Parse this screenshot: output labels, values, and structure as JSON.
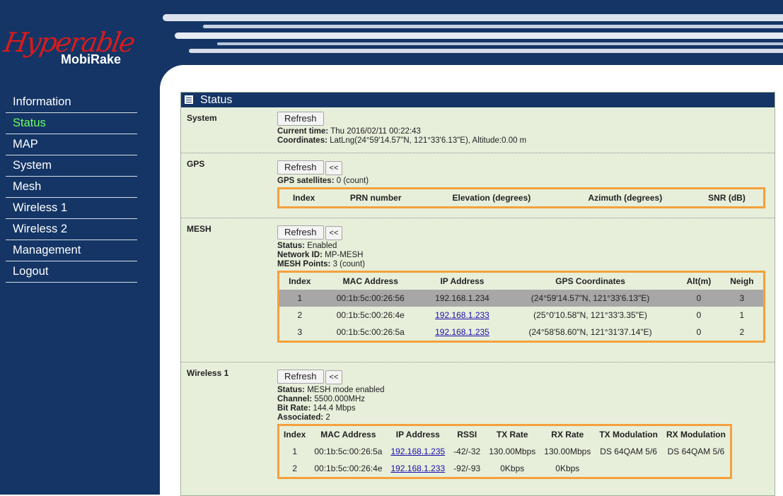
{
  "app": {
    "logo_text": "Hyperable",
    "logo_subtitle": "MobiRake"
  },
  "sidebar": {
    "items": [
      {
        "label": "Information"
      },
      {
        "label": "Status"
      },
      {
        "label": "MAP"
      },
      {
        "label": "System"
      },
      {
        "label": "Mesh"
      },
      {
        "label": "Wireless 1"
      },
      {
        "label": "Wireless 2"
      },
      {
        "label": "Management"
      },
      {
        "label": "Logout"
      }
    ],
    "active": "Status"
  },
  "status": {
    "title": "Status",
    "system": {
      "title": "System",
      "refresh": "Refresh",
      "current_time_label": "Current time:",
      "current_time": "Thu 2016/02/11 00:22:43",
      "coordinates_label": "Coordinates:",
      "coordinates": "LatLng(24°59'14.57\"N, 121°33'6.13\"E), Altitude:0.00 m"
    },
    "gps": {
      "title": "GPS",
      "refresh": "Refresh",
      "back": "<<",
      "satellites_label": "GPS satellites:",
      "satellites": "0 (count)",
      "headers": [
        "Index",
        "PRN number",
        "Elevation (degrees)",
        "Azimuth (degrees)",
        "SNR (dB)"
      ]
    },
    "mesh": {
      "title": "MESH",
      "refresh": "Refresh",
      "back": "<<",
      "status_label": "Status:",
      "status": "Enabled",
      "network_id_label": "Network ID:",
      "network_id": "MP-MESH",
      "points_label": "MESH Points:",
      "points": "3 (count)",
      "headers": [
        "Index",
        "MAC Address",
        "IP Address",
        "GPS Coordinates",
        "Alt(m)",
        "Neigh"
      ],
      "rows": [
        [
          "1",
          "00:1b:5c:00:26:56",
          "192.168.1.234",
          "(24°59'14.57\"N, 121°33'6.13\"E)",
          "0",
          "3"
        ],
        [
          "2",
          "00:1b:5c:00:26:4e",
          "192.168.1.233",
          "(25°0'10.58\"N, 121°33'3.35\"E)",
          "0",
          "1"
        ],
        [
          "3",
          "00:1b:5c:00:26:5a",
          "192.168.1.235",
          "(24°58'58.60\"N, 121°31'37.14\"E)",
          "0",
          "2"
        ]
      ]
    },
    "wireless1": {
      "title": "Wireless 1",
      "refresh": "Refresh",
      "back": "<<",
      "status_label": "Status:",
      "status": "MESH mode enabled",
      "channel_label": "Channel:",
      "channel": "5500.000MHz",
      "bitrate_label": "Bit Rate:",
      "bitrate": "144.4 Mbps",
      "associated_label": "Associated:",
      "associated": "2",
      "headers": [
        "Index",
        "MAC Address",
        "IP Address",
        "RSSI",
        "TX Rate",
        "RX Rate",
        "TX Modulation",
        "RX Modulation"
      ],
      "rows": [
        [
          "1",
          "00:1b:5c:00:26:5a",
          "192.168.1.235",
          "-42/-32",
          "130.00Mbps",
          "130.00Mbps",
          "DS 64QAM 5/6",
          "DS 64QAM 5/6"
        ],
        [
          "2",
          "00:1b:5c:00:26:4e",
          "192.168.1.233",
          "-92/-93",
          "0Kbps",
          "0Kbps",
          "",
          ""
        ]
      ]
    }
  }
}
